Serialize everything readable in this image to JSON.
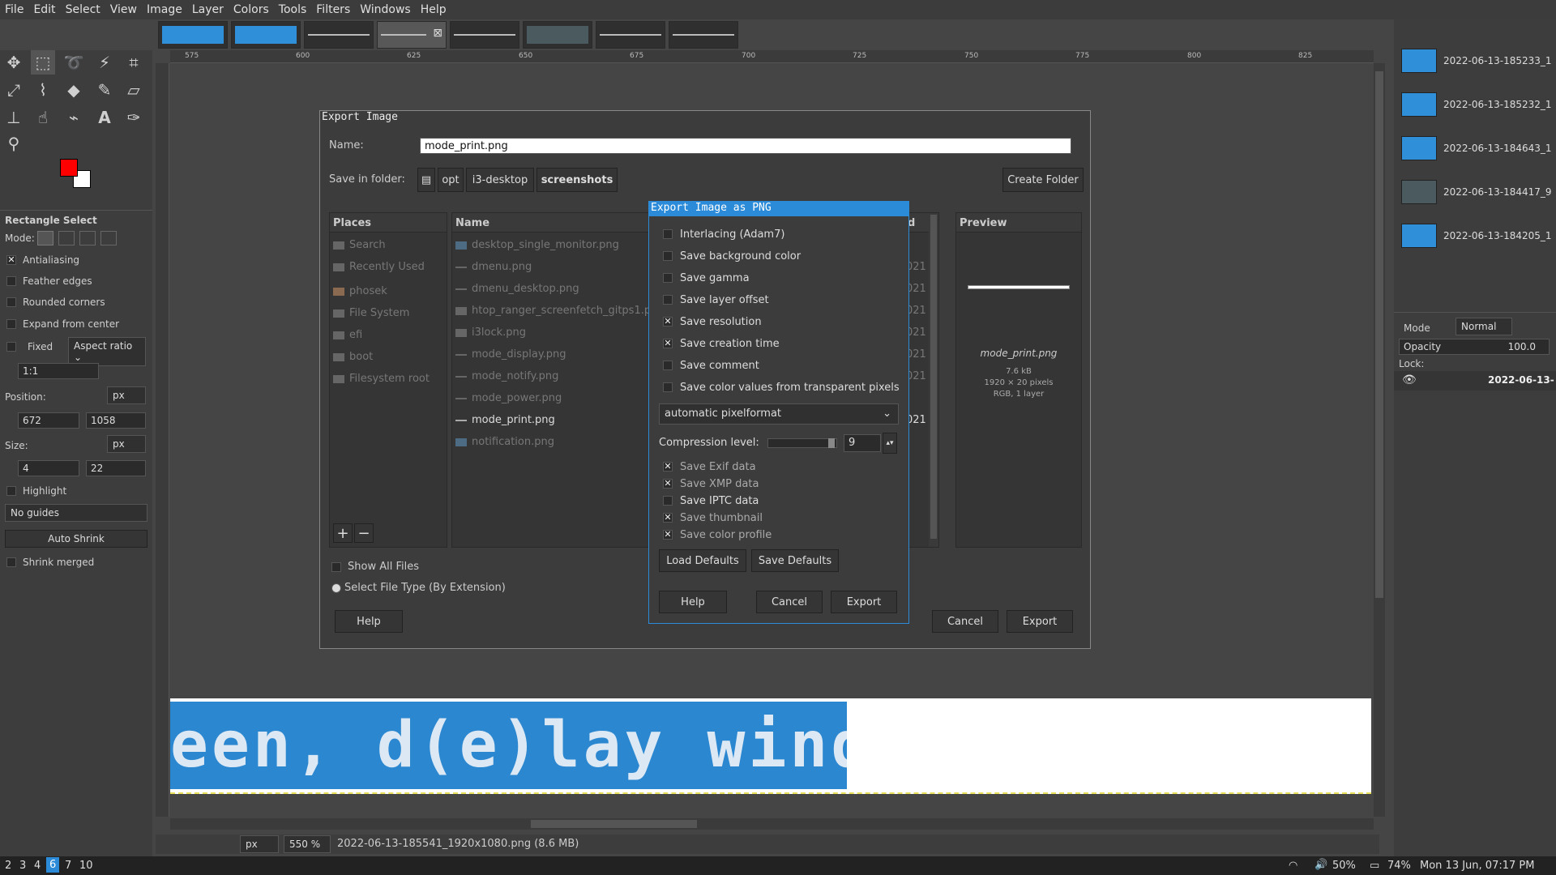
{
  "menubar": [
    "File",
    "Edit",
    "Select",
    "View",
    "Image",
    "Layer",
    "Colors",
    "Tools",
    "Filters",
    "Windows",
    "Help"
  ],
  "toolbox": {
    "tool_name": "Rectangle Select",
    "mode_label": "Mode:",
    "antialiasing": "Antialiasing",
    "feather_edges": "Feather edges",
    "rounded_corners": "Rounded corners",
    "expand_from_center": "Expand from center",
    "fixed": "Fixed",
    "aspect_ratio": "Aspect ratio",
    "ratio_value": "1:1",
    "position_label": "Position:",
    "position_unit": "px",
    "position_x": "672",
    "position_y": "1058",
    "size_label": "Size:",
    "size_unit": "px",
    "size_w": "4",
    "size_h": "22",
    "highlight": "Highlight",
    "guides": "No guides",
    "auto_shrink": "Auto Shrink",
    "shrink_merged": "Shrink merged"
  },
  "ruler_ticks": [
    "575",
    "600",
    "625",
    "650",
    "675",
    "700",
    "725",
    "750",
    "775",
    "800",
    "825"
  ],
  "canvas_text": "een, d(e)lay window",
  "status": {
    "unit": "px",
    "zoom": "550 %",
    "filename": "2022-06-13-185541_1920x1080.png (8.6 MB)"
  },
  "export_dialog": {
    "title": "Export Image",
    "name_label": "Name:",
    "name_value": "mode_print.png",
    "folder_label": "Save in folder:",
    "crumbs": [
      "opt",
      "i3-desktop",
      "screenshots"
    ],
    "create_folder": "Create Folder",
    "places_header": "Places",
    "places": [
      "Search",
      "Recently Used",
      "phosek",
      "File System",
      "efi",
      "boot",
      "Filesystem root"
    ],
    "name_header": "Name",
    "modified_header": "d",
    "files": [
      "desktop_single_monitor.png",
      "dmenu.png",
      "dmenu_desktop.png",
      "htop_ranger_screenfetch_gitps1.p",
      "i3lock.png",
      "mode_display.png",
      "mode_notify.png",
      "mode_power.png",
      "mode_print.png",
      "notification.png"
    ],
    "file_dates": [
      "",
      "021",
      "021",
      "021",
      "021",
      "021",
      "021",
      "",
      "021",
      ""
    ],
    "preview_header": "Preview",
    "preview_name": "mode_print.png",
    "preview_size": "7.6 kB",
    "preview_dims": "1920 × 20 pixels",
    "preview_mode": "RGB, 1 layer",
    "show_all_files": "Show All Files",
    "select_file_type": "Select File Type (By Extension)",
    "help": "Help",
    "cancel": "Cancel",
    "export": "Export"
  },
  "png_dialog": {
    "title": "Export Image as PNG",
    "options": [
      {
        "label": "Interlacing (Adam7)",
        "checked": ""
      },
      {
        "label": "Save background color",
        "checked": ""
      },
      {
        "label": "Save gamma",
        "checked": ""
      },
      {
        "label": "Save layer offset",
        "checked": ""
      },
      {
        "label": "Save resolution",
        "checked": "✕"
      },
      {
        "label": "Save creation time",
        "checked": "✕"
      },
      {
        "label": "Save comment",
        "checked": ""
      },
      {
        "label": "Save color values from transparent pixels",
        "checked": ""
      }
    ],
    "pixelformat": "automatic pixelformat",
    "compression_label": "Compression level:",
    "compression_value": "9",
    "meta": [
      {
        "label": "Save Exif data",
        "checked": "✕"
      },
      {
        "label": "Save XMP data",
        "checked": "✕"
      },
      {
        "label": "Save IPTC data",
        "checked": ""
      },
      {
        "label": "Save thumbnail",
        "checked": "✕"
      },
      {
        "label": "Save color profile",
        "checked": "✕"
      }
    ],
    "load_defaults": "Load Defaults",
    "save_defaults": "Save Defaults",
    "help": "Help",
    "cancel": "Cancel",
    "export": "Export"
  },
  "images_dock": [
    "2022-06-13-185233_1",
    "2022-06-13-185232_1",
    "2022-06-13-184643_1",
    "2022-06-13-184417_9",
    "2022-06-13-184205_1"
  ],
  "layers": {
    "mode_label": "Mode",
    "mode_value": "Normal",
    "opacity_label": "Opacity",
    "opacity_value": "100.0",
    "lock_label": "Lock:",
    "layer_name": "2022-06-13-"
  },
  "taskbar": {
    "workspaces": [
      "2",
      "3",
      "4",
      "6",
      "7",
      "10"
    ],
    "active_workspace": "6",
    "volume": "50%",
    "battery": "74%",
    "clock": "Mon 13 Jun, 07:17 PM"
  },
  "colors": {
    "fg": "#ff0000",
    "bg": "#ffffff",
    "accent": "#2b8bd8"
  }
}
